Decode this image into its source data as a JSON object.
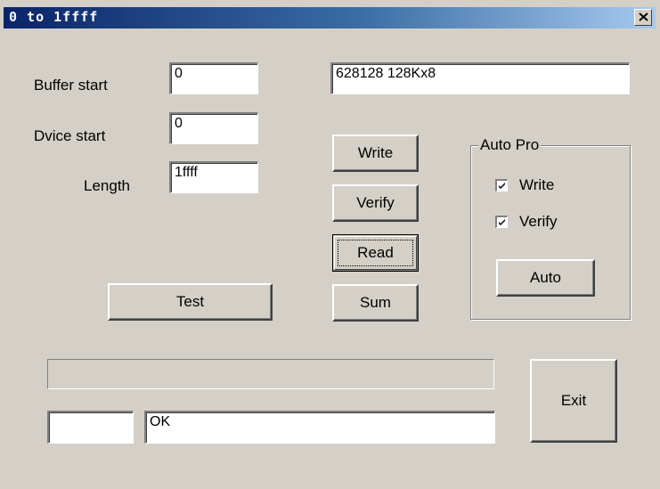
{
  "window": {
    "title": "0 to 1ffff"
  },
  "form": {
    "buffer_start_label": "Buffer start",
    "buffer_start_value": "0",
    "device_start_label": "Dvice start",
    "device_start_value": "0",
    "length_label": "Length",
    "length_value": "1ffff",
    "chip_info": "628128 128Kx8"
  },
  "buttons": {
    "write": "Write",
    "verify": "Verify",
    "read": "Read",
    "sum": "Sum",
    "test": "Test",
    "exit": "Exit"
  },
  "auto_pro": {
    "title": "Auto Pro",
    "write_label": "Write",
    "write_checked": true,
    "verify_label": "Verify",
    "verify_checked": true,
    "auto_button": "Auto"
  },
  "status": {
    "progress_fraction": 0,
    "small_field": "",
    "message": "OK"
  },
  "icons": {
    "close": "close-icon",
    "check": "check-icon"
  }
}
